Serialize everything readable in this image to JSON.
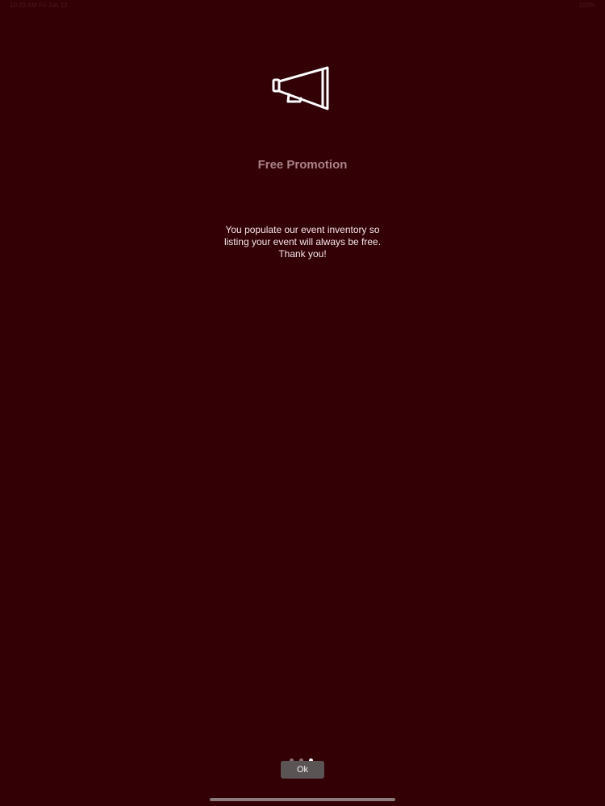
{
  "status_bar": {
    "left_text": "10:23 AM   Fri Jun 12",
    "right_text": "100%"
  },
  "icon": "megaphone-icon",
  "title": "Free Promotion",
  "message": {
    "line1": "You populate our event inventory so",
    "line2": "listing your event will always be free.",
    "line3": "Thank you!"
  },
  "pager": {
    "page_count": 3,
    "active_page": 3
  },
  "ok_button": {
    "label": "Ok"
  },
  "colors": {
    "background": "#330005",
    "title": "#a88488",
    "text": "#f2e8e9",
    "button": "#5b5455"
  }
}
